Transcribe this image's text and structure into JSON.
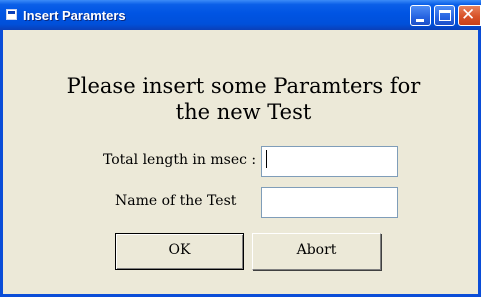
{
  "window": {
    "title": "Insert Paramters",
    "colors": {
      "titlebar": "#0054E3",
      "frame": "#0A4DD8",
      "background": "#ECE9D8",
      "close_button": "#D8532A"
    },
    "controls": {
      "minimize_icon": "minimize-icon",
      "maximize_icon": "maximize-icon",
      "close_icon": "close-icon",
      "close_glyph": "✕"
    }
  },
  "form": {
    "heading_line1": "Please insert some Paramters for",
    "heading_line2": "the new Test",
    "length_label": "Total length in msec :",
    "length_value": "",
    "name_label": "Name of the Test",
    "name_value": ""
  },
  "buttons": {
    "ok_label": "OK",
    "abort_label": "Abort"
  }
}
